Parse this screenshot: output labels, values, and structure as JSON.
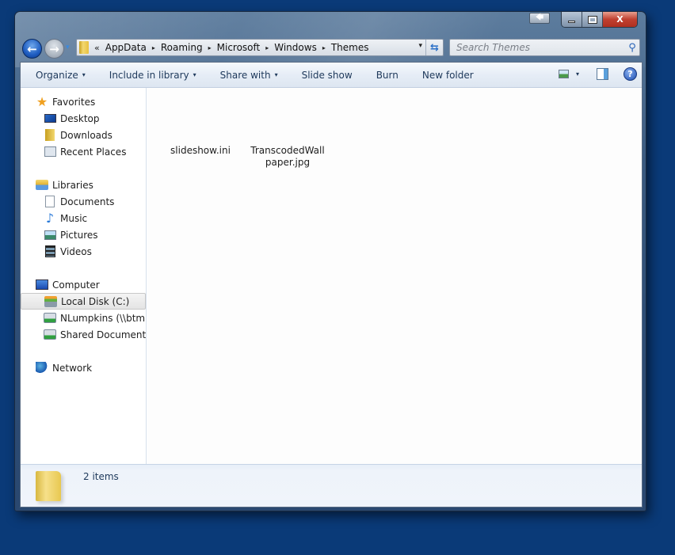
{
  "window": {
    "title_buttons": {
      "snap_icon": "arrow-left-icon",
      "minimize_icon": "minimize-icon",
      "maximize_icon": "maximize-icon",
      "close_label": "X"
    }
  },
  "navigation": {
    "back_icon": "←",
    "forward_icon": "→",
    "recent_icon": "▾"
  },
  "address_bar": {
    "overflow_label": "«",
    "breadcrumbs": [
      "AppData",
      "Roaming",
      "Microsoft",
      "Windows",
      "Themes"
    ],
    "separator": "▸",
    "dropdown_icon": "▾",
    "refresh_icon": "⇆"
  },
  "search": {
    "placeholder": "Search Themes",
    "value": "",
    "icon": "⚲"
  },
  "toolbar": {
    "items": [
      {
        "label": "Organize",
        "has_dropdown": true
      },
      {
        "label": "Include in library",
        "has_dropdown": true
      },
      {
        "label": "Share with",
        "has_dropdown": true
      },
      {
        "label": "Slide show",
        "has_dropdown": false
      },
      {
        "label": "Burn",
        "has_dropdown": false
      },
      {
        "label": "New folder",
        "has_dropdown": false
      }
    ],
    "dropdown_arrow": "▾",
    "help_label": "?"
  },
  "nav_pane": {
    "favorites": {
      "label": "Favorites",
      "items": [
        "Desktop",
        "Downloads",
        "Recent Places"
      ]
    },
    "libraries": {
      "label": "Libraries",
      "items": [
        "Documents",
        "Music",
        "Pictures",
        "Videos"
      ]
    },
    "computer": {
      "label": "Computer",
      "items": [
        "Local Disk (C:)",
        "NLumpkins (\\\\btmia",
        "Shared Documents ("
      ],
      "selected": "Local Disk (C:)"
    },
    "network": {
      "label": "Network"
    }
  },
  "files": [
    {
      "name": "slideshow.ini"
    },
    {
      "name": "TranscodedWallpaper.jpg"
    }
  ],
  "details": {
    "item_count": "2 items"
  },
  "colors": {
    "desktop_bg": "#0a3a78",
    "toolbar_text": "#1e395b",
    "close_button": "#c04030"
  }
}
